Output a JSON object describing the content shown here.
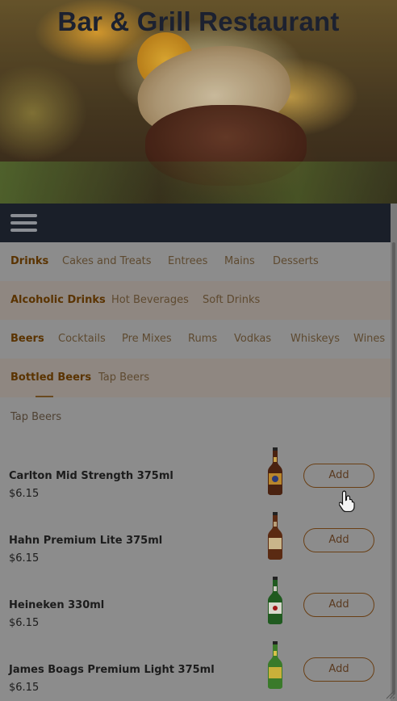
{
  "header": {
    "title": "Bar & Grill Restaurant"
  },
  "nav": {
    "menu_icon": "hamburger-menu-icon"
  },
  "categories": [
    {
      "label": "Drinks",
      "active": true
    },
    {
      "label": "Cakes and Treats",
      "active": false
    },
    {
      "label": "Entrees",
      "active": false
    },
    {
      "label": "Mains",
      "active": false
    },
    {
      "label": "Desserts",
      "active": false
    }
  ],
  "subcategories": [
    {
      "label": "Alcoholic Drinks",
      "active": true
    },
    {
      "label": "Hot Beverages",
      "active": false
    },
    {
      "label": "Soft Drinks",
      "active": false
    }
  ],
  "types": [
    {
      "label": "Beers",
      "active": true
    },
    {
      "label": "Cocktails",
      "active": false
    },
    {
      "label": "Pre Mixes",
      "active": false
    },
    {
      "label": "Rums",
      "active": false
    },
    {
      "label": "Vodkas",
      "active": false
    },
    {
      "label": "Whiskeys",
      "active": false
    },
    {
      "label": "Wines",
      "active": false
    }
  ],
  "beer_types": [
    {
      "label": "Bottled Beers",
      "active": true
    },
    {
      "label": "Tap Beers",
      "active": false
    }
  ],
  "section_label": "Tap Beers",
  "items": [
    {
      "name": "Carlton Mid Strength 375ml",
      "price": "$6.15",
      "add_label": "Add",
      "bottle_icon": "brown-beer-bottle-icon"
    },
    {
      "name": "Hahn Premium Lite 375ml",
      "price": "$6.15",
      "add_label": "Add",
      "bottle_icon": "brown-beer-bottle-icon"
    },
    {
      "name": "Heineken 330ml",
      "price": "$6.15",
      "add_label": "Add",
      "bottle_icon": "green-beer-bottle-icon"
    },
    {
      "name": "James Boags Premium Light 375ml",
      "price": "$6.15",
      "add_label": "Add",
      "bottle_icon": "green-beer-bottle-icon"
    }
  ],
  "colors": {
    "overlay": "#8c8c8c",
    "navbar": "#1a1f29",
    "accent": "#6a3f14",
    "active_tab": "#5a3300"
  }
}
